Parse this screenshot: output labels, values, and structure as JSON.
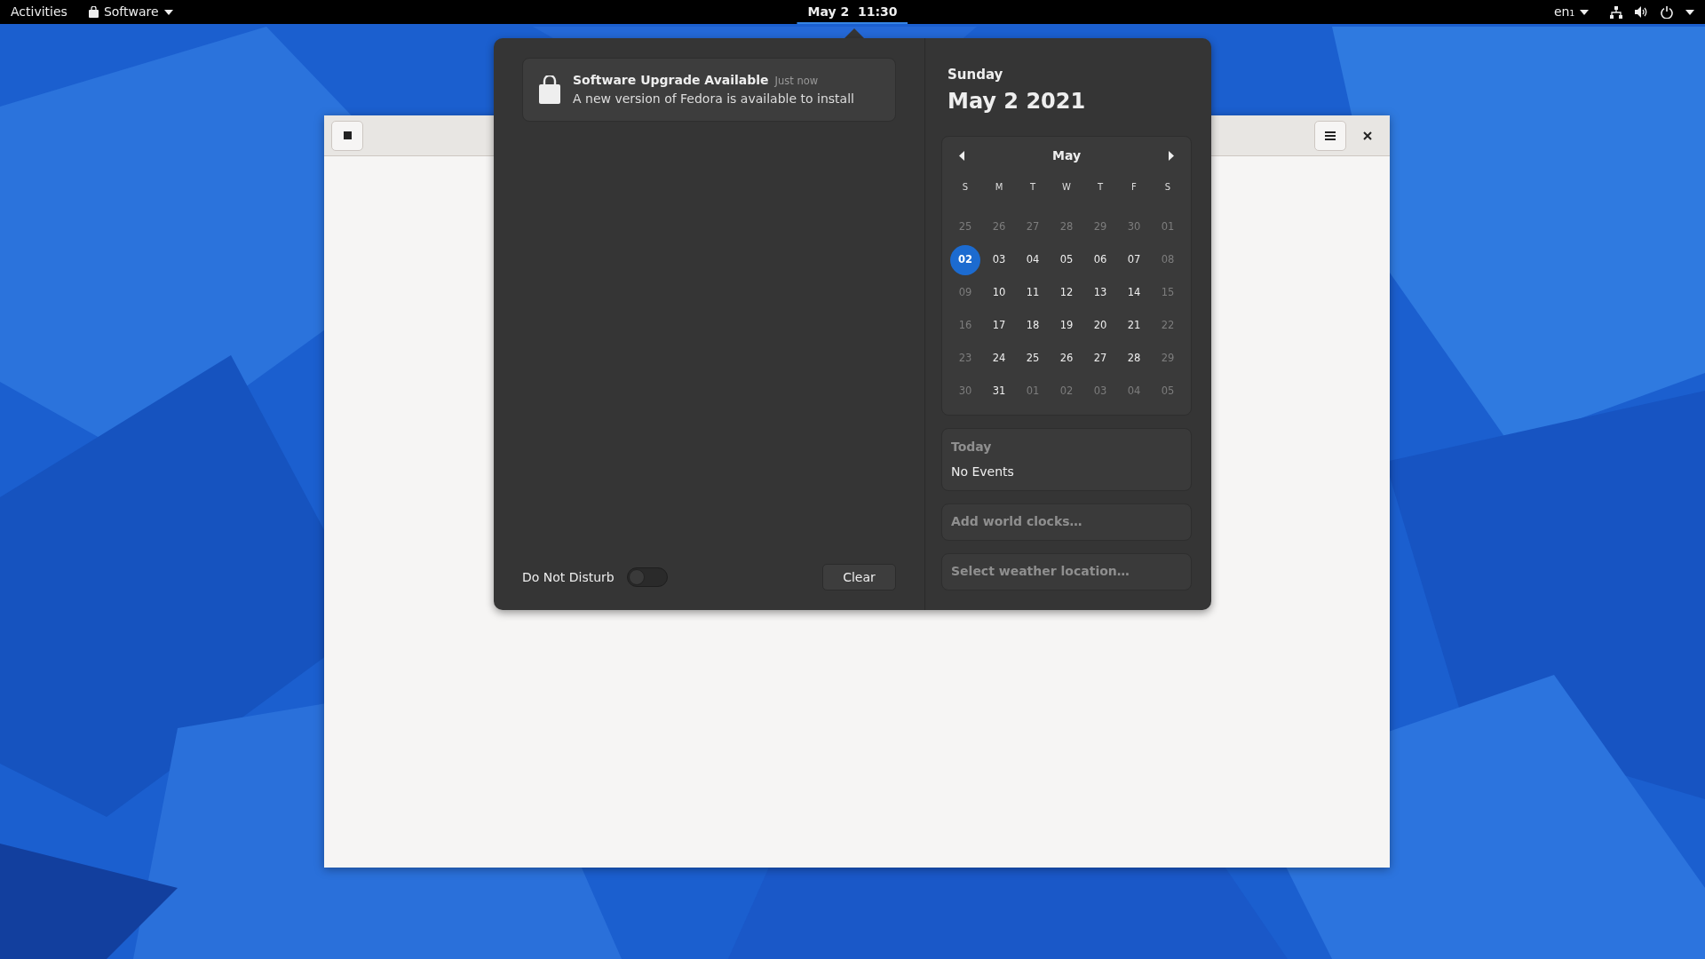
{
  "top_bar": {
    "activities": "Activities",
    "app_menu": "Software",
    "clock": {
      "label": "May 2  11:30",
      "active": true
    },
    "input_source": "en₁"
  },
  "notifications": [
    {
      "title": "Software Upgrade Available",
      "time": "Just now",
      "body": "A new version of Fedora is available to install"
    }
  ],
  "do_not_disturb": {
    "label": "Do Not Disturb",
    "on": false
  },
  "clear_button": "Clear",
  "date": {
    "weekday": "Sunday",
    "full": "May 2 2021"
  },
  "calendar": {
    "month": "May",
    "weekdays": [
      "S",
      "M",
      "T",
      "W",
      "T",
      "F",
      "S"
    ],
    "weeks": [
      [
        {
          "label": "25",
          "dim": true,
          "selected": false
        },
        {
          "label": "26",
          "dim": true,
          "selected": false
        },
        {
          "label": "27",
          "dim": true,
          "selected": false
        },
        {
          "label": "28",
          "dim": true,
          "selected": false
        },
        {
          "label": "29",
          "dim": true,
          "selected": false
        },
        {
          "label": "30",
          "dim": true,
          "selected": false
        },
        {
          "label": "01",
          "dim": true,
          "selected": false
        }
      ],
      [
        {
          "label": "02",
          "dim": false,
          "selected": true
        },
        {
          "label": "03",
          "dim": false,
          "selected": false
        },
        {
          "label": "04",
          "dim": false,
          "selected": false
        },
        {
          "label": "05",
          "dim": false,
          "selected": false
        },
        {
          "label": "06",
          "dim": false,
          "selected": false
        },
        {
          "label": "07",
          "dim": false,
          "selected": false
        },
        {
          "label": "08",
          "dim": true,
          "selected": false
        }
      ],
      [
        {
          "label": "09",
          "dim": true,
          "selected": false
        },
        {
          "label": "10",
          "dim": false,
          "selected": false
        },
        {
          "label": "11",
          "dim": false,
          "selected": false
        },
        {
          "label": "12",
          "dim": false,
          "selected": false
        },
        {
          "label": "13",
          "dim": false,
          "selected": false
        },
        {
          "label": "14",
          "dim": false,
          "selected": false
        },
        {
          "label": "15",
          "dim": true,
          "selected": false
        }
      ],
      [
        {
          "label": "16",
          "dim": true,
          "selected": false
        },
        {
          "label": "17",
          "dim": false,
          "selected": false
        },
        {
          "label": "18",
          "dim": false,
          "selected": false
        },
        {
          "label": "19",
          "dim": false,
          "selected": false
        },
        {
          "label": "20",
          "dim": false,
          "selected": false
        },
        {
          "label": "21",
          "dim": false,
          "selected": false
        },
        {
          "label": "22",
          "dim": true,
          "selected": false
        }
      ],
      [
        {
          "label": "23",
          "dim": true,
          "selected": false
        },
        {
          "label": "24",
          "dim": false,
          "selected": false
        },
        {
          "label": "25",
          "dim": false,
          "selected": false
        },
        {
          "label": "26",
          "dim": false,
          "selected": false
        },
        {
          "label": "27",
          "dim": false,
          "selected": false
        },
        {
          "label": "28",
          "dim": false,
          "selected": false
        },
        {
          "label": "29",
          "dim": true,
          "selected": false
        }
      ],
      [
        {
          "label": "30",
          "dim": true,
          "selected": false
        },
        {
          "label": "31",
          "dim": false,
          "selected": false
        },
        {
          "label": "01",
          "dim": true,
          "selected": false
        },
        {
          "label": "02",
          "dim": true,
          "selected": false
        },
        {
          "label": "03",
          "dim": true,
          "selected": false
        },
        {
          "label": "04",
          "dim": true,
          "selected": false
        },
        {
          "label": "05",
          "dim": true,
          "selected": false
        }
      ]
    ]
  },
  "events": {
    "heading": "Today",
    "text": "No Events"
  },
  "world_clocks": "Add world clocks…",
  "weather": "Select weather location…"
}
